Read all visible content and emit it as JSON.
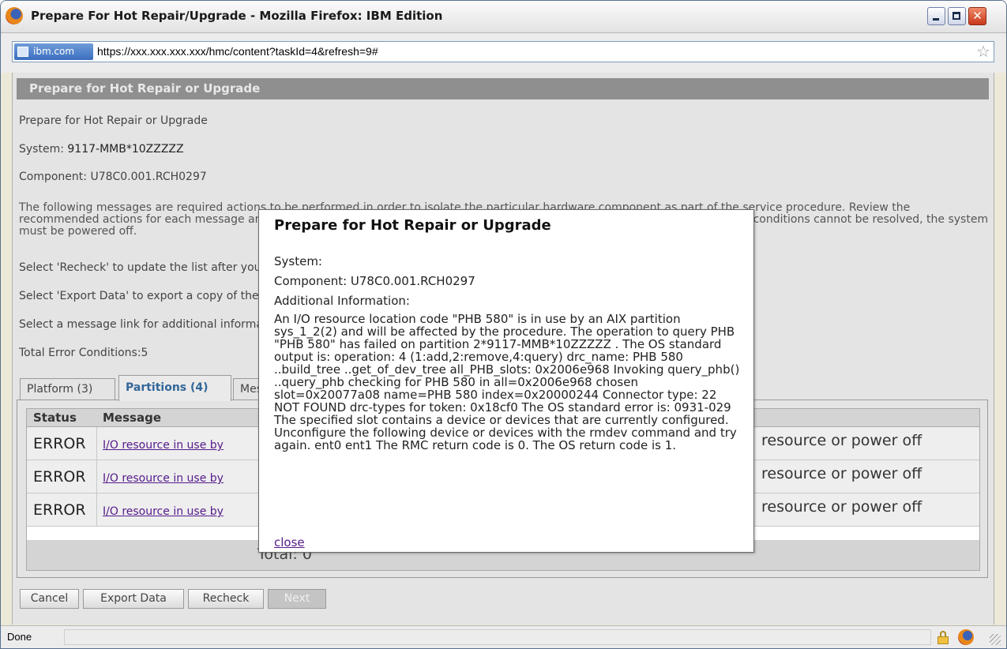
{
  "window": {
    "title": "Prepare For Hot Repair/Upgrade - Mozilla Firefox: IBM Edition",
    "url_site": "ibm.com",
    "url": "https://xxx.xxx.xxx.xxx/hmc/content?taskId=4&refresh=9#",
    "status": "Done"
  },
  "page": {
    "header": "Prepare for Hot Repair or Upgrade",
    "heading": "Prepare for Hot Repair or Upgrade",
    "system_label": "System:",
    "system_value": "9117-MMB*10ZZZZZ",
    "component": "Component: U78C0.001.RCH0297",
    "description": "The following messages are required actions to be performed in order to isolate the particular hardware component as part of the service procedure. Review the recommended actions for each message and correct the error conditions before proceeding with the hardware operation. If all error conditions cannot be resolved, the system must be powered off.",
    "recheck_text": "Select 'Recheck' to update the list after you have performed the recommended actions.",
    "export_text": "Select 'Export Data' to export a copy of the data for later reference.",
    "message_link_text": "Select a message link for additional information.",
    "total_errors": "Total Error Conditions:5",
    "tabs": [
      {
        "label": "Platform (3)"
      },
      {
        "label": "Partitions (4)"
      },
      {
        "label": "Messages"
      }
    ],
    "table": {
      "headers": {
        "status": "Status",
        "message": "Message"
      },
      "rows": [
        {
          "status": "ERROR",
          "message": "I/O resource in use by",
          "action": "resource or power off"
        },
        {
          "status": "ERROR",
          "message": "I/O resource in use by",
          "action": "resource or power off"
        },
        {
          "status": "ERROR",
          "message": "I/O resource in use by",
          "action": "resource or power off"
        }
      ],
      "total": "Total: 0"
    },
    "buttons": {
      "cancel": "Cancel",
      "export": "Export Data",
      "recheck": "Recheck",
      "next": "Next"
    }
  },
  "popup": {
    "title": "Prepare for Hot Repair or Upgrade",
    "system": "System:",
    "component": "Component: U78C0.001.RCH0297",
    "additional": "Additional Information:",
    "info": "An I/O resource location code \"PHB 580\" is in use by an AIX partition sys_1_2(2) and will be affected by the procedure. The operation to query PHB \"PHB 580\" has failed on partition 2*9117-MMB*10ZZZZZ . The OS standard output is: operation: 4 (1:add,2:remove,4:query) drc_name: PHB 580 ..build_tree ..get_of_dev_tree all_PHB_slots: 0x2006e968 Invoking query_phb() ..query_phb checking for PHB 580 in all=0x2006e968 chosen slot=0x20077a08 name=PHB 580 index=0x20000244 Connector type: 22 NOT FOUND drc-types for token: 0x18cf0 The OS standard error is: 0931-029 The specified slot contains a device or devices that are currently configured. Unconfigure the following device or devices with the rmdev command and try again. ent0 ent1 The RMC return code is 0. The OS return code is 1.",
    "close": "close"
  }
}
